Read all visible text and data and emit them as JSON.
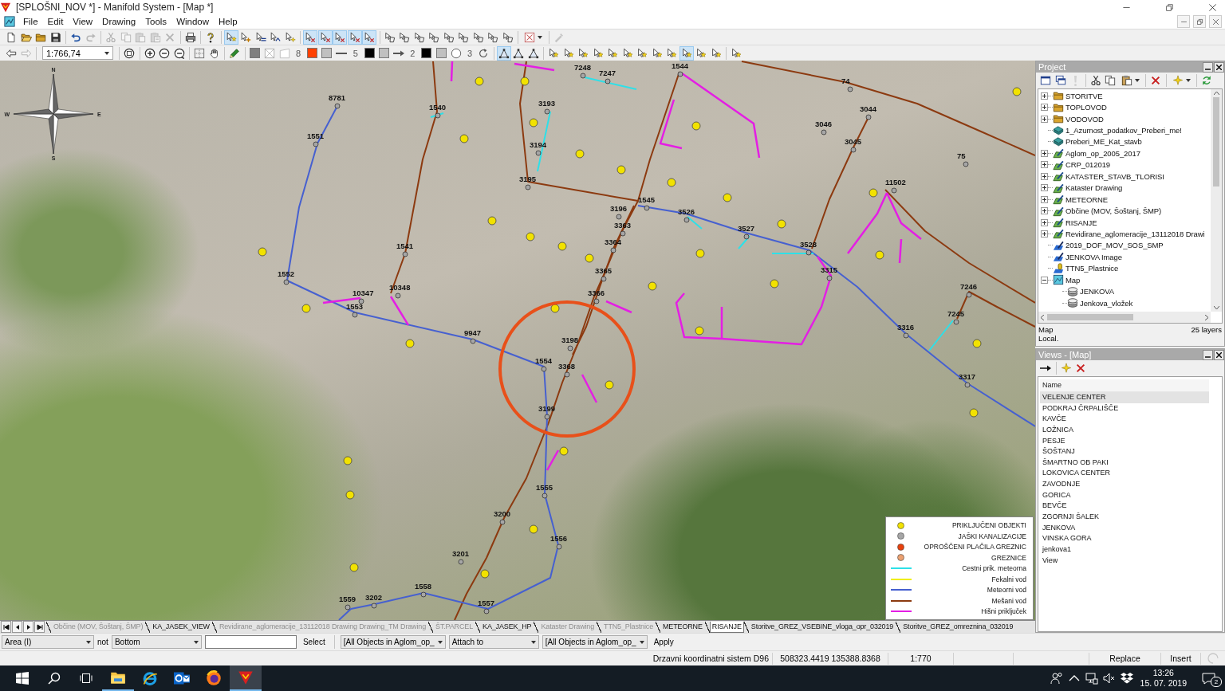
{
  "window": {
    "title": "[SPLOŠNI_NOV *] - Manifold System - [Map *]"
  },
  "menu": [
    "File",
    "Edit",
    "View",
    "Drawing",
    "Tools",
    "Window",
    "Help"
  ],
  "toolbar_1": [
    [
      {
        "kind": "new"
      },
      {
        "kind": "open"
      },
      {
        "kind": "folder"
      },
      {
        "kind": "save"
      }
    ],
    [
      {
        "kind": "undo",
        "disabled": false
      },
      {
        "kind": "redo",
        "disabled": true
      }
    ],
    [
      {
        "kind": "cut",
        "disabled": true
      },
      {
        "kind": "copy",
        "disabled": true
      },
      {
        "kind": "paste",
        "disabled": true
      },
      {
        "kind": "paste_special",
        "disabled": true
      },
      {
        "kind": "delete",
        "disabled": true
      }
    ],
    [
      {
        "kind": "print"
      }
    ],
    [
      {
        "kind": "help"
      }
    ],
    [
      {
        "kind": "pick_star",
        "pressed": true
      },
      {
        "kind": "pick_add",
        "pressed": false
      },
      {
        "kind": "pick_line",
        "pressed": false
      },
      {
        "kind": "pick_move",
        "pressed": false
      },
      {
        "kind": "pick_spark",
        "pressed": false
      }
    ],
    [
      {
        "kind": "select_mode",
        "pressed": true
      },
      {
        "kind": "select_mode",
        "pressed": true
      },
      {
        "kind": "select_mode",
        "pressed": true
      },
      {
        "kind": "select_mode",
        "pressed": true
      },
      {
        "kind": "select_mode",
        "pressed": true
      }
    ],
    [
      {
        "kind": "select_shape"
      },
      {
        "kind": "select_shape"
      },
      {
        "kind": "select_shape"
      },
      {
        "kind": "select_shape"
      },
      {
        "kind": "select_shape"
      },
      {
        "kind": "select_shape"
      },
      {
        "kind": "select_shape"
      },
      {
        "kind": "select_shape"
      },
      {
        "kind": "select_shape"
      }
    ],
    [
      {
        "kind": "select_box_menu"
      }
    ],
    [
      {
        "kind": "tool",
        "disabled": true
      }
    ]
  ],
  "toolbar_2": [
    [
      {
        "kind": "back",
        "disabled": false
      },
      {
        "kind": "forward",
        "disabled": true
      }
    ],
    [
      {
        "kind": "scale",
        "value": "1:766,74"
      }
    ],
    [
      {
        "kind": "zoom_window"
      }
    ],
    [
      {
        "kind": "zoom_in"
      },
      {
        "kind": "zoom_out"
      },
      {
        "kind": "zoom_fit"
      }
    ],
    [
      {
        "kind": "grid"
      },
      {
        "kind": "pan"
      }
    ],
    [
      {
        "kind": "pick"
      }
    ],
    [
      {
        "kind": "swatch",
        "color": "#808080"
      },
      {
        "kind": "pattern"
      },
      {
        "kind": "border"
      },
      {
        "kind": "number",
        "text": "8"
      },
      {
        "kind": "swatch",
        "color": "#ff4000"
      },
      {
        "kind": "swatch",
        "color": "#c0c0c0"
      },
      {
        "kind": "line"
      },
      {
        "kind": "number",
        "text": "5"
      },
      {
        "kind": "swatch",
        "color": "#000000"
      },
      {
        "kind": "swatch",
        "color": "#c0c0c0"
      },
      {
        "kind": "arrow"
      },
      {
        "kind": "number",
        "text": "2"
      },
      {
        "kind": "swatch",
        "color": "#000000"
      },
      {
        "kind": "swatch",
        "color": "#c0c0c0"
      },
      {
        "kind": "circle"
      },
      {
        "kind": "number",
        "text": "3"
      },
      {
        "kind": "rotate"
      }
    ],
    [
      {
        "kind": "vertex",
        "pressed": true
      },
      {
        "kind": "vertex",
        "pressed": false
      },
      {
        "kind": "vertex",
        "pressed": false
      }
    ],
    [
      {
        "kind": "star_tool",
        "pressed": false
      },
      {
        "kind": "star_tool",
        "pressed": false
      },
      {
        "kind": "star_tool",
        "pressed": false
      },
      {
        "kind": "star_tool",
        "pressed": false
      },
      {
        "kind": "star_tool",
        "pressed": false
      },
      {
        "kind": "star_tool",
        "pressed": false
      },
      {
        "kind": "star_tool",
        "pressed": false
      },
      {
        "kind": "star_tool",
        "pressed": false
      },
      {
        "kind": "star_tool",
        "pressed": false
      },
      {
        "kind": "star_tool",
        "pressed": true
      },
      {
        "kind": "star_tool",
        "pressed": false
      },
      {
        "kind": "star_tool",
        "pressed": false
      }
    ],
    [
      {
        "kind": "star_tool",
        "pressed": false
      }
    ]
  ],
  "map": {
    "compass": [
      "N",
      "E",
      "S",
      "W"
    ],
    "manhole_labels": [
      "7248",
      "7247",
      "1544",
      "74",
      "8781",
      "1540",
      "3193",
      "3044",
      "3046",
      "1551",
      "3194",
      "3045",
      "75",
      "3195",
      "11502",
      "1545",
      "3196",
      "3526",
      "3363",
      "3527",
      "1541",
      "3364",
      "3528",
      "1552",
      "3365",
      "3315",
      "10347",
      "10348",
      "3366",
      "7246",
      "1553",
      "7245",
      "9947",
      "3316",
      "3198",
      "1554",
      "3368",
      "3317",
      "3199",
      "1555",
      "3200",
      "1556",
      "3201",
      "1558",
      "1559",
      "3202",
      "1557"
    ],
    "legend": [
      {
        "kind": "point",
        "color": "#f2e200",
        "label": "PRIKLJUČENI OBJEKTI"
      },
      {
        "kind": "point",
        "color": "#a6a6a6",
        "label": "JAŠKI KANALIZACIJE"
      },
      {
        "kind": "point",
        "color": "#e8400c",
        "label": "OPROŠČENI PLAČILA GREZNIC"
      },
      {
        "kind": "point",
        "color": "#eba070",
        "label": "GREZNICE"
      },
      {
        "kind": "line",
        "color": "#2ee0e8",
        "label": "Cestni prik. meteorna"
      },
      {
        "kind": "line",
        "color": "#f0ee10",
        "label": "Fekalni vod"
      },
      {
        "kind": "line",
        "color": "#4660d0",
        "label": "Meteorni vod"
      },
      {
        "kind": "line",
        "color": "#8c3a10",
        "label": "Mešani vod"
      },
      {
        "kind": "line",
        "color": "#e41ee4",
        "label": "Hišni priključek"
      }
    ]
  },
  "layer_tabs": [
    {
      "label": "Občine (MOV, Šoštanj, ŠMP)",
      "visible": false,
      "selected": false
    },
    {
      "label": "KA_JASEK_VIEW",
      "visible": true,
      "selected": false
    },
    {
      "label": "Revidirane_aglomeracije_13112018 Drawing Drawing_TM Drawing",
      "visible": false,
      "selected": false
    },
    {
      "label": "ŠT.PARCEL",
      "visible": false,
      "selected": false
    },
    {
      "label": "KA_JASEK_HP",
      "visible": true,
      "selected": false
    },
    {
      "label": "Kataster Drawing",
      "visible": false,
      "selected": false
    },
    {
      "label": "TTN5_Plastnice",
      "visible": false,
      "selected": false
    },
    {
      "label": "METEORNE",
      "visible": true,
      "selected": false
    },
    {
      "label": "RISANJE",
      "visible": true,
      "selected": true
    },
    {
      "label": "Storitve_GREZ_VSEBINE_vloga_opr_032019",
      "visible": true,
      "selected": false
    },
    {
      "label": "Storitve_GREZ_omreznina_032019",
      "visible": true,
      "selected": false
    }
  ],
  "project": {
    "title": "Project",
    "toolbar": [
      [
        {
          "kind": "window",
          "disabled": false
        },
        {
          "kind": "cascade",
          "disabled": false
        },
        {
          "kind": "run",
          "disabled": true
        }
      ],
      [
        {
          "kind": "cut"
        },
        {
          "kind": "copy"
        },
        {
          "kind": "paste_menu"
        }
      ],
      [
        {
          "kind": "delete_red"
        }
      ],
      [
        {
          "kind": "new_menu"
        }
      ],
      [
        {
          "kind": "refresh"
        }
      ]
    ],
    "items": [
      {
        "kind": "folder",
        "label": "STORITVE",
        "expanded": false
      },
      {
        "kind": "folder",
        "label": "TOPLOVOD",
        "expanded": false
      },
      {
        "kind": "folder",
        "label": "VODOVOD",
        "expanded": false
      },
      {
        "kind": "comments",
        "label": "1_Azurnost_podatkov_Preberi_me!"
      },
      {
        "kind": "comments",
        "label": "Preberi_ME_Kat_stavb"
      },
      {
        "kind": "drawing",
        "label": "Aglom_op_2005_2017",
        "expanded": false
      },
      {
        "kind": "drawing",
        "label": "CRP_012019",
        "expanded": false
      },
      {
        "kind": "drawing",
        "label": "KATASTER_STAVB_TLORISI",
        "expanded": false
      },
      {
        "kind": "drawing",
        "label": "Kataster Drawing",
        "expanded": false
      },
      {
        "kind": "drawing",
        "label": "METEORNE",
        "expanded": false
      },
      {
        "kind": "drawing",
        "label": "Občine (MOV, Šoštanj, ŠMP)",
        "expanded": false
      },
      {
        "kind": "drawing",
        "label": "RISANJE",
        "expanded": false
      },
      {
        "kind": "drawing",
        "label": "Revidirane_aglomeracije_13112018 Drawi",
        "expanded": false
      },
      {
        "kind": "image",
        "label": "2019_DOF_MOV_SOS_SMP"
      },
      {
        "kind": "image",
        "label": "JENKOVA Image"
      },
      {
        "kind": "surface",
        "label": "TTN5_Plastnice"
      },
      {
        "kind": "map",
        "label": "Map",
        "expanded": true,
        "children": [
          {
            "kind": "layer",
            "label": "JENKOVA"
          },
          {
            "kind": "layer",
            "label": "Jenkova_vložek"
          }
        ]
      }
    ],
    "footer": {
      "type": "Map",
      "count": "25 layers",
      "location": "Local."
    }
  },
  "views": {
    "title": "Views - [Map]",
    "toolbar": [
      [
        {
          "kind": "open_view"
        }
      ],
      [
        {
          "kind": "new_view"
        },
        {
          "kind": "delete_red"
        }
      ]
    ],
    "column": "Name",
    "items": [
      {
        "label": "VELENJE CENTER",
        "selected": true
      },
      {
        "label": "PODKRAJ ČRPALIŠČE",
        "selected": false
      },
      {
        "label": "KAVČE",
        "selected": false
      },
      {
        "label": "LOŽNICA",
        "selected": false
      },
      {
        "label": "PESJE",
        "selected": false
      },
      {
        "label": "ŠOŠTANJ",
        "selected": false
      },
      {
        "label": "ŠMARTNO OB PAKI",
        "selected": false
      },
      {
        "label": "LOKOVICA CENTER",
        "selected": false
      },
      {
        "label": "ZAVODNJE",
        "selected": false
      },
      {
        "label": "GORICA",
        "selected": false
      },
      {
        "label": "BEVČE",
        "selected": false
      },
      {
        "label": "ZGORNJI ŠALEK",
        "selected": false
      },
      {
        "label": "JENKOVA",
        "selected": false
      },
      {
        "label": "VINSKA GORA",
        "selected": false
      },
      {
        "label": "jenkova1",
        "selected": false
      },
      {
        "label": "View",
        "selected": false
      }
    ]
  },
  "query_bar": {
    "scope": "Area (I)",
    "negation": "not",
    "position": "Bottom",
    "select_button": "Select",
    "source": "[All Objects in Aglom_op_",
    "action": "Attach to",
    "target": "[All Objects in Aglom_op_",
    "apply_button": "Apply"
  },
  "status_bar": [
    "Drzavni koordinatni sistem D96",
    "508323.4419 135388.8368",
    "1:770",
    "Replace",
    "Insert"
  ],
  "taskbar": {
    "apps": [
      {
        "kind": "files",
        "running": true,
        "active": false
      },
      {
        "kind": "browser_e",
        "running": false,
        "active": false
      },
      {
        "kind": "mail",
        "running": false,
        "active": false
      },
      {
        "kind": "browser_fox",
        "running": false,
        "active": false
      },
      {
        "kind": "gis",
        "running": true,
        "active": true
      }
    ],
    "time": "13:26",
    "date": "15. 07. 2019",
    "notifications": "2"
  }
}
